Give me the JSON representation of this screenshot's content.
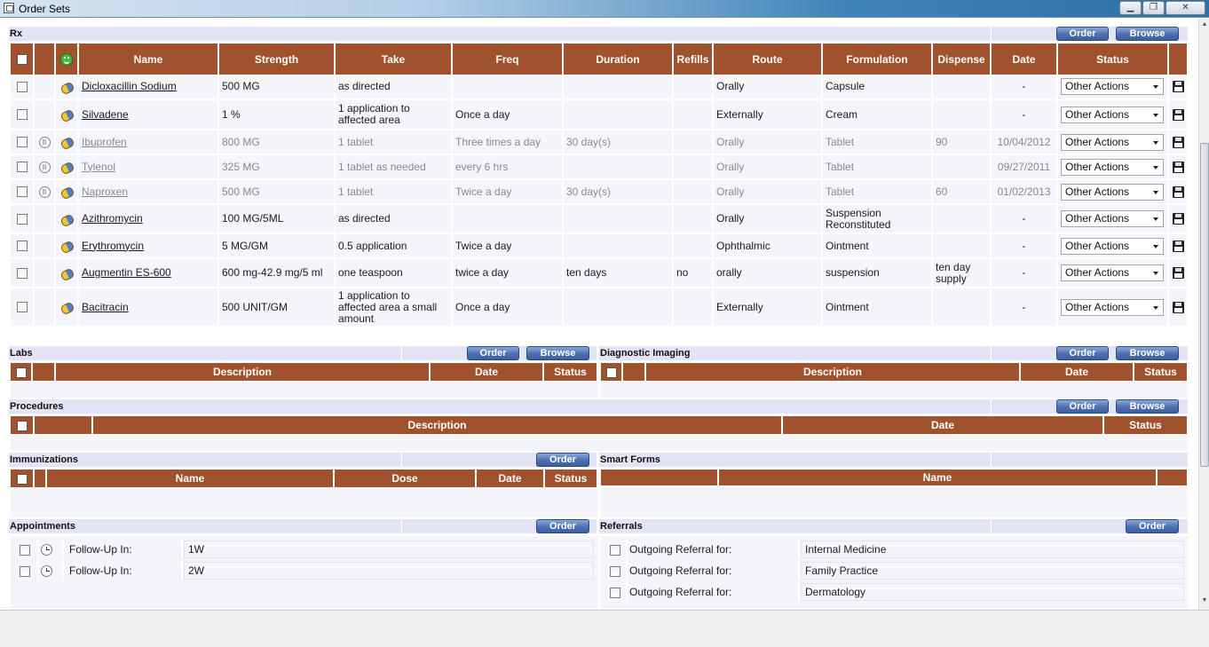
{
  "window": {
    "title": "Order Sets",
    "minimize": "▁",
    "maximize": "❐",
    "close": "✕"
  },
  "icons": {
    "rx_pill": "prescription-pill-icon",
    "smiley": "smiley-icon",
    "hold": "hold-icon",
    "save": "floppy-disk-icon",
    "clock": "clock-icon"
  },
  "colors": {
    "header_brown": "#a0522d",
    "section_bar": "#e2e4f6",
    "row_bg": "#f4f5fb",
    "button_blue": "#4e6fb0"
  },
  "rx": {
    "label": "Rx",
    "order_button": "Order",
    "browse_button": "Browse",
    "columns": [
      "Name",
      "Strength",
      "Take",
      "Freq",
      "Duration",
      "Refills",
      "Route",
      "Formulation",
      "Dispense",
      "Date",
      "Status"
    ],
    "status_select_default": "Other Actions",
    "rows": [
      {
        "name": "Dicloxacillin Sodium",
        "strength": "500 MG",
        "take": "as directed",
        "freq": "",
        "duration": "",
        "refills": "",
        "route": "Orally",
        "formulation": "Capsule",
        "dispense": "",
        "date": "-",
        "status": "Other Actions",
        "on_hold": false
      },
      {
        "name": "Silvadene",
        "strength": "1 %",
        "take": "1 application to affected area",
        "freq": "Once a day",
        "duration": "",
        "refills": "",
        "route": "Externally",
        "formulation": "Cream",
        "dispense": "",
        "date": "-",
        "status": "Other Actions",
        "on_hold": false
      },
      {
        "name": "Ibuprofen",
        "strength": "800 MG",
        "take": "1 tablet",
        "freq": "Three times a day",
        "duration": "30 day(s)",
        "refills": "",
        "route": "Orally",
        "formulation": "Tablet",
        "dispense": "90",
        "date": "10/04/2012",
        "status": "Other Actions",
        "on_hold": true
      },
      {
        "name": "Tylenol",
        "strength": "325 MG",
        "take": "1 tablet as needed",
        "freq": "every 6 hrs",
        "duration": "",
        "refills": "",
        "route": "Orally",
        "formulation": "Tablet",
        "dispense": "",
        "date": "09/27/2011",
        "status": "Other Actions",
        "on_hold": true
      },
      {
        "name": "Naproxen",
        "strength": "500 MG",
        "take": "1 tablet",
        "freq": "Twice a day",
        "duration": "30 day(s)",
        "refills": "",
        "route": "Orally",
        "formulation": "Tablet",
        "dispense": "60",
        "date": "01/02/2013",
        "status": "Other Actions",
        "on_hold": true
      },
      {
        "name": "Azithromycin",
        "strength": "100 MG/5ML",
        "take": "as directed",
        "freq": "",
        "duration": "",
        "refills": "",
        "route": "Orally",
        "formulation": "Suspension Reconstituted",
        "dispense": "",
        "date": "-",
        "status": "Other Actions",
        "on_hold": false
      },
      {
        "name": "Erythromycin",
        "strength": "5 MG/GM",
        "take": "0.5 application",
        "freq": "Twice a day",
        "duration": "",
        "refills": "",
        "route": "Ophthalmic",
        "formulation": "Ointment",
        "dispense": "",
        "date": "-",
        "status": "Other Actions",
        "on_hold": false
      },
      {
        "name": "Augmentin ES-600",
        "strength": "600 mg-42.9 mg/5 ml",
        "take": "one teaspoon",
        "freq": "twice a day",
        "duration": "ten days",
        "refills": "no",
        "route": "orally",
        "formulation": "suspension",
        "dispense": "ten day supply",
        "date": "-",
        "status": "Other Actions",
        "on_hold": false
      },
      {
        "name": "Bacitracin",
        "strength": "500 UNIT/GM",
        "take": "1 application to affected area a small amount",
        "freq": "Once a day",
        "duration": "",
        "refills": "",
        "route": "Externally",
        "formulation": "Ointment",
        "dispense": "",
        "date": "-",
        "status": "Other Actions",
        "on_hold": false
      }
    ]
  },
  "labs": {
    "label": "Labs",
    "order_button": "Order",
    "browse_button": "Browse",
    "columns": [
      "Description",
      "Date",
      "Status"
    ]
  },
  "diagnostic_imaging": {
    "label": "Diagnostic Imaging",
    "order_button": "Order",
    "browse_button": "Browse",
    "columns": [
      "Description",
      "Date",
      "Status"
    ]
  },
  "procedures": {
    "label": "Procedures",
    "order_button": "Order",
    "browse_button": "Browse",
    "columns": [
      "Description",
      "Date",
      "Status"
    ]
  },
  "immunizations": {
    "label": "Immunizations",
    "order_button": "Order",
    "columns": [
      "Name",
      "Dose",
      "Date",
      "Status"
    ]
  },
  "smart_forms": {
    "label": "Smart Forms",
    "columns": [
      "Name"
    ]
  },
  "appointments": {
    "label": "Appointments",
    "order_button": "Order",
    "rows": [
      {
        "label": "Follow-Up In:",
        "value": "1W"
      },
      {
        "label": "Follow-Up In:",
        "value": "2W"
      }
    ]
  },
  "referrals": {
    "label": "Referrals",
    "order_button": "Order",
    "rows": [
      {
        "label": "Outgoing Referral for:",
        "value": "Internal Medicine"
      },
      {
        "label": "Outgoing Referral for:",
        "value": "Family Practice"
      },
      {
        "label": "Outgoing Referral for:",
        "value": "Dermatology"
      }
    ]
  }
}
